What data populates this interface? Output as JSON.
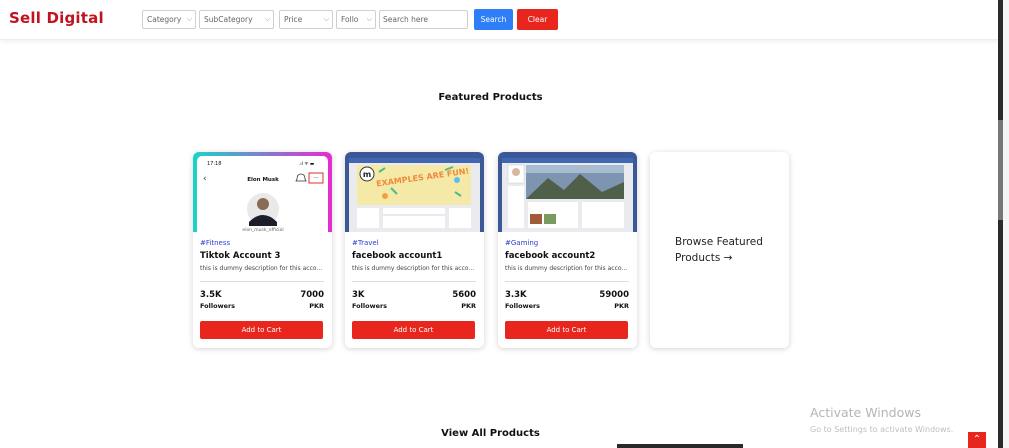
{
  "header": {
    "brand": "Sell Digital",
    "filters": {
      "category": "Category",
      "subcategory": "SubCategory",
      "price": "Price",
      "followers": "Follo"
    },
    "search": {
      "placeholder": "Search here",
      "value": ""
    },
    "search_label": "Search",
    "clear_label": "Clear"
  },
  "featured": {
    "title": "Featured Products",
    "products": [
      {
        "category": "#Fitness",
        "title": "Tiktok Account 3",
        "description": "this is dummy description for this acco...",
        "followers": "3.5K",
        "followers_label": "Followers",
        "price": "7000",
        "currency": "PKR",
        "button": "Add to Cart",
        "image": {
          "time": "17:18",
          "name": "Elon Musk",
          "handle": "elon_musk_official"
        }
      },
      {
        "category": "#Travel",
        "title": "facebook account1",
        "description": "this is dummy description for this acco...",
        "followers": "3K",
        "followers_label": "Followers",
        "price": "5600",
        "currency": "PKR",
        "button": "Add to Cart",
        "image": {
          "banner": "EXAMPLES ARE FUN!"
        }
      },
      {
        "category": "#Gaming",
        "title": "facebook account2",
        "description": "this is dummy description for this acco...",
        "followers": "3.3K",
        "followers_label": "Followers",
        "price": "59000",
        "currency": "PKR",
        "button": "Add to Cart"
      }
    ],
    "browse_label": "Browse Featured Products →"
  },
  "all_products": {
    "title": "View All Products"
  },
  "windows_watermark": {
    "title": "Activate Windows",
    "subtitle": "Go to Settings to activate Windows."
  },
  "colors": {
    "brand": "#c1121f",
    "primary_blue": "#2d7ef7",
    "accent_red": "#e8261e",
    "category_link": "#2f3bd4",
    "facebook_blue": "#3b5998"
  },
  "icons": {
    "dropdown": "chevron-down-icon",
    "scroll_top": "arrow-up-icon"
  }
}
